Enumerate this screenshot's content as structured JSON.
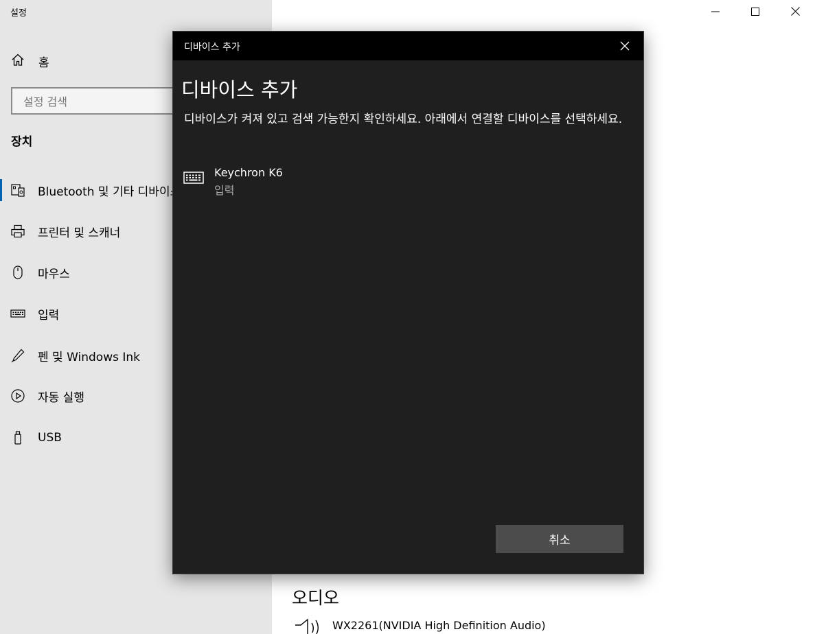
{
  "window": {
    "title": "설정",
    "controls": {
      "minimize": "minimize-icon",
      "maximize": "maximize-icon",
      "close": "close-icon"
    }
  },
  "sidebar": {
    "home_label": "홈",
    "search_placeholder": "설정 검색",
    "section_title": "장치",
    "items": [
      {
        "label": "Bluetooth 및 기타 디바이스",
        "icon": "bluetooth-devices-icon",
        "selected": true
      },
      {
        "label": "프린터 및 스캐너",
        "icon": "printer-icon"
      },
      {
        "label": "마우스",
        "icon": "mouse-icon"
      },
      {
        "label": "입력",
        "icon": "keyboard-icon"
      },
      {
        "label": "펜 및 Windows Ink",
        "icon": "pen-icon"
      },
      {
        "label": "자동 실행",
        "icon": "autoplay-icon"
      },
      {
        "label": "USB",
        "icon": "usb-icon"
      }
    ],
    "accent_color": "#0063b1"
  },
  "main": {
    "audio_title": "오디오",
    "audio_device": "WX2261(NVIDIA High Definition Audio)"
  },
  "dialog": {
    "titlebar": "디바이스 추가",
    "heading": "디바이스 추가",
    "description": "디바이스가 켜져 있고 검색 가능한지 확인하세요. 아래에서 연결할 디바이스를 선택하세요.",
    "devices": [
      {
        "name": "Keychron K6",
        "type": "입력",
        "icon": "keyboard-icon"
      }
    ],
    "cancel_label": "취소",
    "background": "#1f1f1f",
    "button_color": "#4c4c4c"
  }
}
